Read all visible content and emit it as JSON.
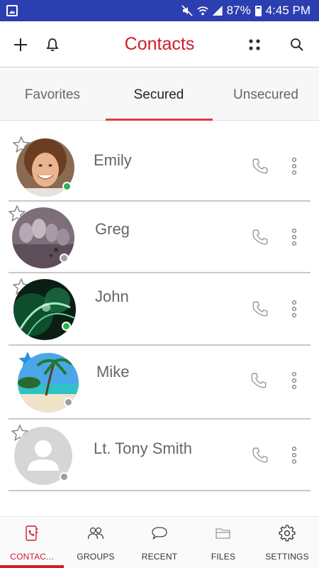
{
  "status_bar": {
    "battery": "87%",
    "time": "4:45 PM",
    "icons": [
      "gallery-icon",
      "mute-icon",
      "wifi-icon",
      "signal-icon",
      "battery-icon"
    ]
  },
  "app_bar": {
    "title": "Contacts",
    "icons": [
      "add-icon",
      "bell-icon",
      "grid-icon",
      "search-icon"
    ]
  },
  "tabs": [
    {
      "label": "Favorites",
      "active": false
    },
    {
      "label": "Secured",
      "active": true
    },
    {
      "label": "Unsecured",
      "active": false
    }
  ],
  "contacts": [
    {
      "name": "Emily",
      "favorite": false,
      "status": "online",
      "avatar": "woman-portrait"
    },
    {
      "name": "Greg",
      "favorite": false,
      "status": "offline",
      "avatar": "mount-rushmore"
    },
    {
      "name": "John",
      "favorite": false,
      "status": "online",
      "avatar": "green-abstract"
    },
    {
      "name": "Mike",
      "favorite": true,
      "status": "offline",
      "avatar": "tropical-beach"
    },
    {
      "name": "Lt. Tony Smith",
      "favorite": false,
      "status": "offline",
      "avatar": "default-person"
    }
  ],
  "bottom_nav": [
    {
      "label": "CONTAC...",
      "icon": "contacts-icon",
      "active": true
    },
    {
      "label": "GROUPS",
      "icon": "groups-icon",
      "active": false
    },
    {
      "label": "RECENT",
      "icon": "chat-bubble-icon",
      "active": false
    },
    {
      "label": "FILES",
      "icon": "folder-icon",
      "active": false
    },
    {
      "label": "SETTINGS",
      "icon": "gear-icon",
      "active": false
    }
  ],
  "colors": {
    "status_bar": "#2c3fb0",
    "accent": "#d01c2a",
    "online": "#2bb24c",
    "offline": "#9e9e9e",
    "favorite_star": "#2a8fe0"
  }
}
